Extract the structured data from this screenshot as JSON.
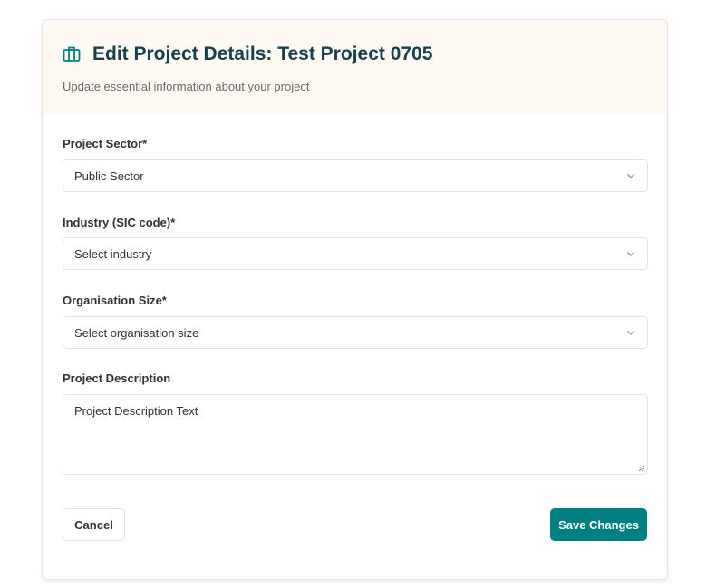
{
  "header": {
    "title": "Edit Project Details: Test Project 0705",
    "subtitle": "Update essential information about your project",
    "icon": "briefcase-icon"
  },
  "fields": {
    "sector": {
      "label": "Project Sector*",
      "value": "Public Sector"
    },
    "industry": {
      "label": "Industry (SIC code)*",
      "value": "Select industry"
    },
    "size": {
      "label": "Organisation Size*",
      "value": "Select organisation size"
    },
    "description": {
      "label": "Project Description",
      "value": "Project Description Text"
    }
  },
  "actions": {
    "cancel": "Cancel",
    "save": "Save Changes"
  },
  "colors": {
    "accent": "#008080",
    "header_bg": "#fff9f3",
    "title": "#16404c"
  }
}
